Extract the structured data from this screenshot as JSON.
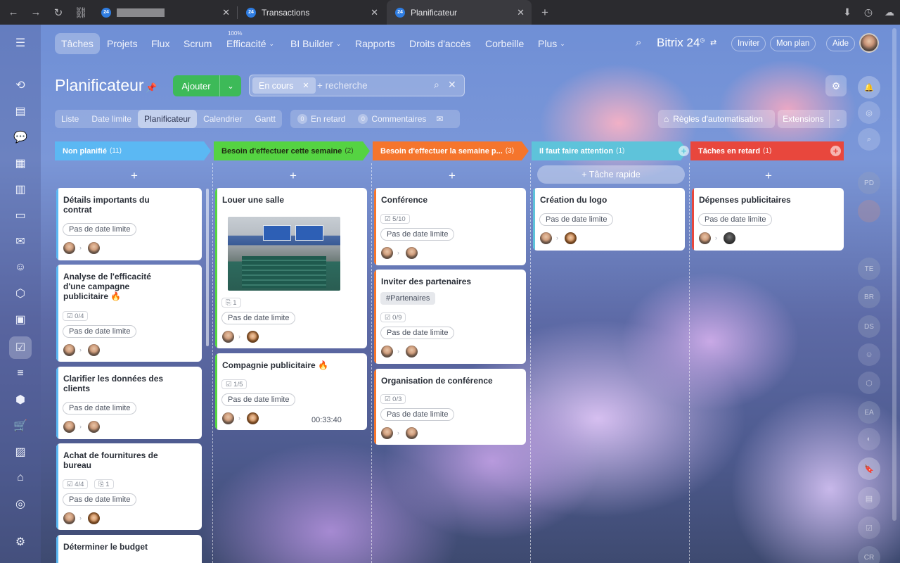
{
  "browser": {
    "tabs": [
      {
        "label": "",
        "favicon": "24"
      },
      {
        "label": "Transactions",
        "favicon": "24"
      },
      {
        "label": "Planificateur",
        "favicon": "24"
      }
    ]
  },
  "topnav": {
    "items": [
      "Tâches",
      "Projets",
      "Flux",
      "Scrum",
      "Efficacité",
      "BI Builder",
      "Rapports",
      "Droits d'accès",
      "Corbeille",
      "Plus"
    ],
    "efficiency_badge": "100%",
    "brand": "Bitrix 24",
    "invite": "Inviter",
    "plan": "Mon plan",
    "help": "Aide"
  },
  "header": {
    "title": "Planificateur",
    "add_label": "Ajouter",
    "filter_chip": "En cours",
    "search_placeholder": "+ recherche"
  },
  "views": [
    "Liste",
    "Date limite",
    "Planificateur",
    "Calendrier",
    "Gantt"
  ],
  "counters": {
    "overdue_count": "0",
    "overdue_label": "En retard",
    "comments_count": "0",
    "comments_label": "Commentaires"
  },
  "toolbar": {
    "rules": "Règles d'automatisation",
    "extensions": "Extensions"
  },
  "quick_task": "+ Tâche rapide",
  "columns": [
    {
      "title": "Non planifié",
      "count": "(11)",
      "color": "#5bb8f3"
    },
    {
      "title": "Besoin d'effectuer cette semaine",
      "count": "(2)",
      "color": "#55d342"
    },
    {
      "title": "Besoin d'effectuer la semaine p...",
      "count": "(3)",
      "color": "#f5752c"
    },
    {
      "title": "Il faut faire attention",
      "count": "(1)",
      "color": "#5ec3da"
    },
    {
      "title": "Tâches en retard",
      "count": "(1)",
      "color": "#e8473d"
    }
  ],
  "cards": {
    "c1": {
      "title": "Détails importants du contrat",
      "badge": "Pas de date limite"
    },
    "c2": {
      "title": "Analyse de l'efficacité d'une campagne publicitaire",
      "checklist": "0/4",
      "badge": "Pas de date limite"
    },
    "c3": {
      "title": "Clarifier les données des clients",
      "badge": "Pas de date limite"
    },
    "c4": {
      "title": "Achat de fournitures de bureau",
      "checklist": "4/4",
      "files": "1",
      "badge": "Pas de date limite"
    },
    "c5": {
      "title": "Déterminer le budget"
    },
    "d1": {
      "title": "Louer une salle",
      "files": "1",
      "badge": "Pas de date limite"
    },
    "d2": {
      "title": "Compagnie publicitaire",
      "checklist": "1/5",
      "badge": "Pas de date limite",
      "timer": "00:33:40"
    },
    "e1": {
      "title": "Conférence",
      "checklist": "5/10",
      "badge": "Pas de date limite"
    },
    "e2": {
      "title": "Inviter des partenaires",
      "tag": "#Partenaires",
      "checklist": "0/9",
      "badge": "Pas de date limite"
    },
    "e3": {
      "title": "Organisation de conférence",
      "checklist": "0/3",
      "badge": "Pas de date limite"
    },
    "f1": {
      "title": "Création du logo",
      "badge": "Pas de date limite"
    },
    "g1": {
      "title": "Dépenses publicitaires",
      "badge": "Pas de date limite"
    }
  },
  "right_rail": {
    "initials": [
      "PD",
      "TE",
      "BR",
      "DS",
      "EA",
      "CR"
    ]
  }
}
